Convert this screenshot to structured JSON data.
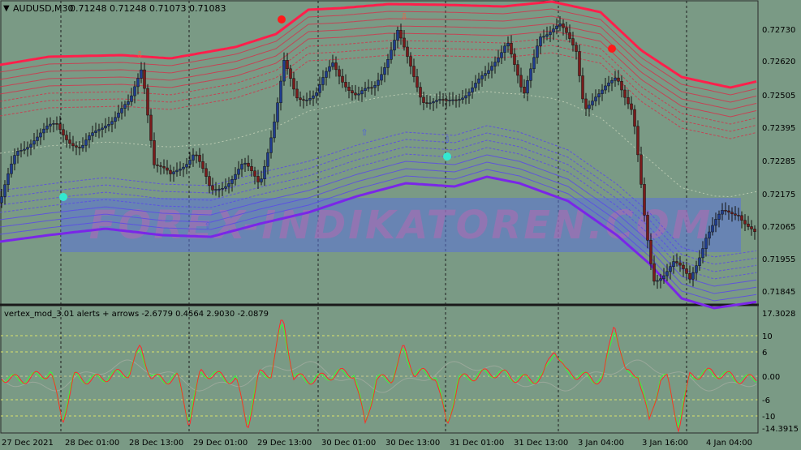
{
  "header": {
    "symbol_label": "AUDUSD,M30",
    "ohlc": "0.71248 0.71248 0.71073 0.71083"
  },
  "watermark": "FOREX-INDIKATOREN.COM",
  "indicator_label": "vertex_mod_3.01 alerts + arrows -2.6779 0.4564 2.9030 -2.0879",
  "price_axis": [
    "0.72730",
    "0.72620",
    "0.72505",
    "0.72395",
    "0.72285",
    "0.72175",
    "0.72065",
    "0.71955",
    "0.71845"
  ],
  "indicator_axis": [
    "17.3028",
    "10",
    "6",
    "0.00",
    "-6",
    "-10",
    "-14.3915"
  ],
  "time_axis": [
    "27 Dec 2021",
    "28 Dec 01:00",
    "28 Dec 13:00",
    "29 Dec 01:00",
    "29 Dec 13:00",
    "30 Dec 01:00",
    "30 Dec 13:00",
    "31 Dec 01:00",
    "31 Dec 13:00",
    "3 Jan 04:00",
    "3 Jan 16:00",
    "4 Jan 04:00"
  ],
  "colors": {
    "background": "#7a9a85",
    "bull_candle": "#1f3c8f",
    "bear_candle": "#7a1b1b",
    "upper_band": "#ff1f4b",
    "lower_band": "#7a26e8",
    "watermark_box": "#5a72d8",
    "oscillator_red": "#ff2a2a",
    "oscillator_green": "#33ff33",
    "level_lines": "#d9e36a"
  }
}
